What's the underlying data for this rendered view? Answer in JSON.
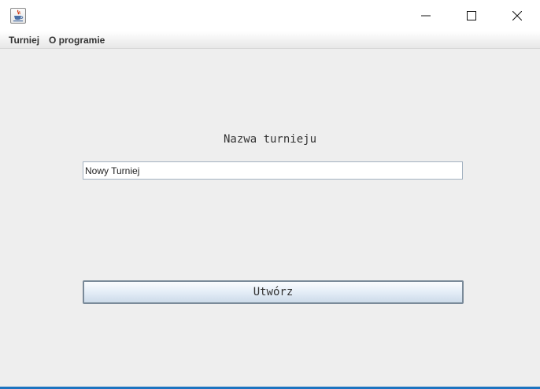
{
  "window": {
    "icon": "java-coffee-cup-icon",
    "controls": [
      "minimize-icon",
      "maximize-icon",
      "close-icon"
    ]
  },
  "menubar": {
    "items": [
      {
        "label": "Turniej"
      },
      {
        "label": "O programie"
      }
    ]
  },
  "form": {
    "name_label": "Nazwa turnieju",
    "name_value": "Nowy Turniej",
    "create_button": "Utwórz"
  }
}
